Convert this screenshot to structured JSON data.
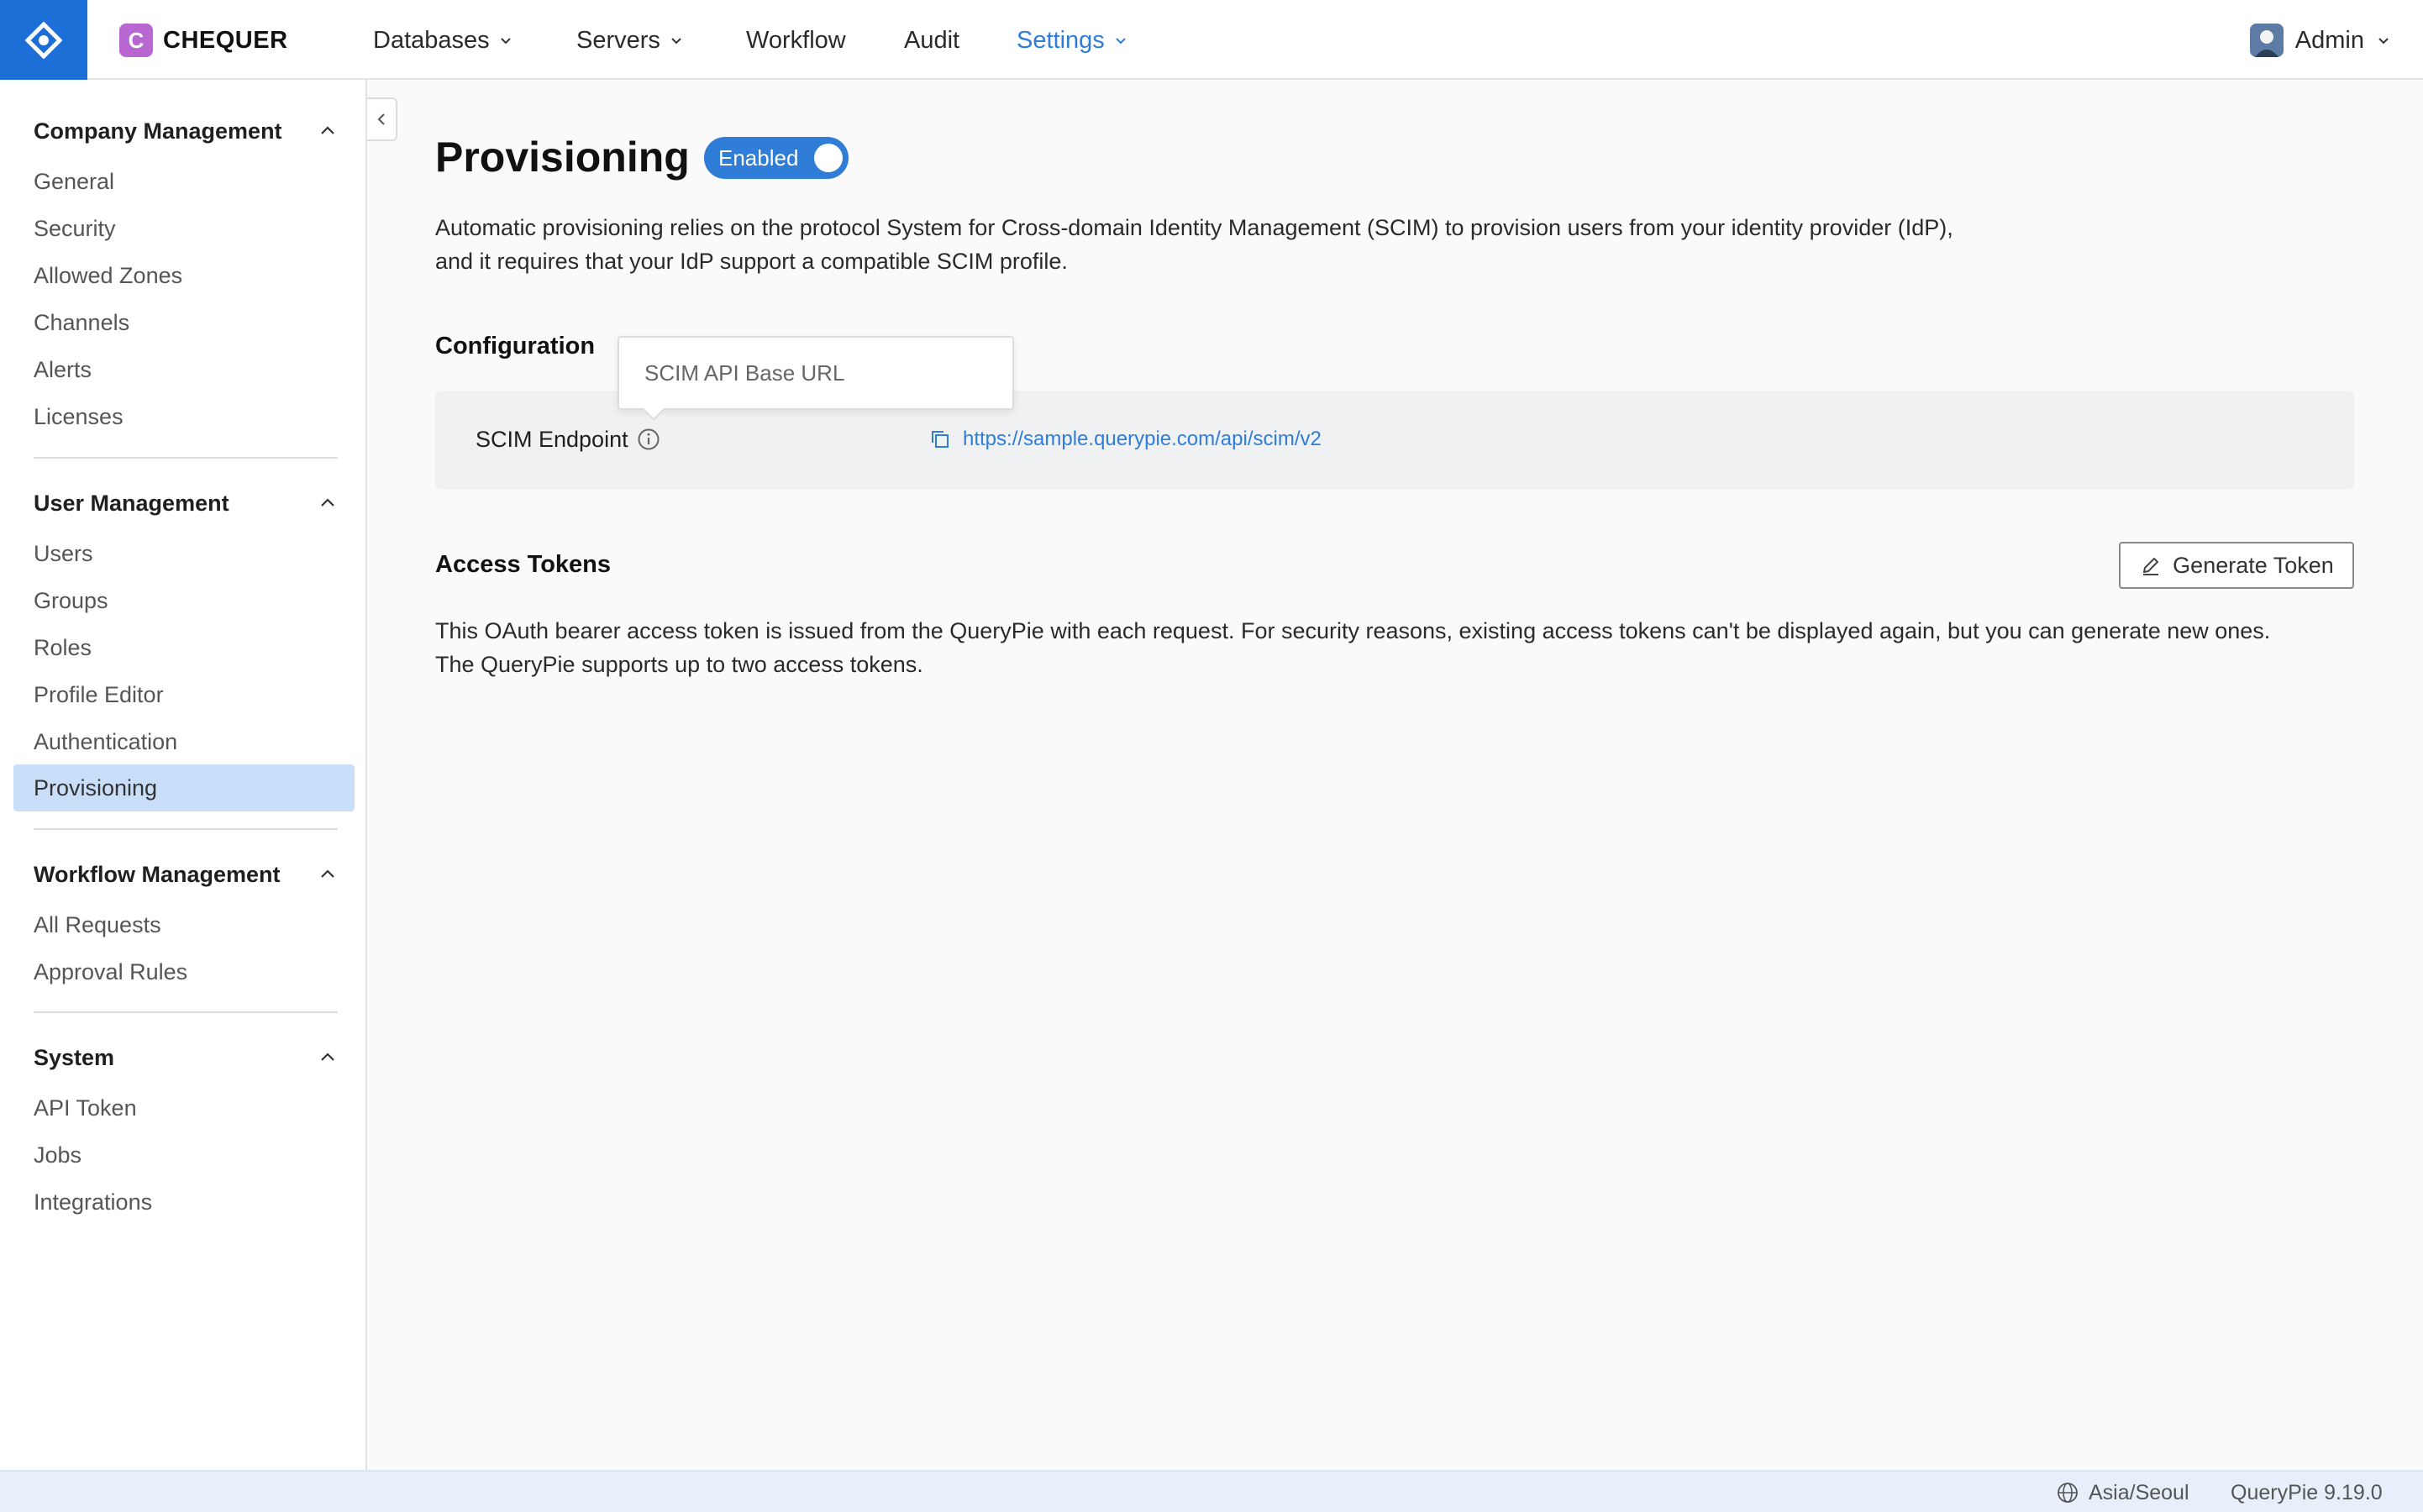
{
  "header": {
    "brand": "CHEQUER",
    "brand_badge": "C",
    "nav": [
      {
        "label": "Databases",
        "has_dropdown": true
      },
      {
        "label": "Servers",
        "has_dropdown": true
      },
      {
        "label": "Workflow",
        "has_dropdown": false
      },
      {
        "label": "Audit",
        "has_dropdown": false
      },
      {
        "label": "Settings",
        "has_dropdown": true,
        "active": true
      }
    ],
    "user": "Admin",
    "accent": "#2f7dd6",
    "logo_color": "#1d6fd8"
  },
  "sidebar": {
    "sections": [
      {
        "title": "Company Management",
        "items": [
          "General",
          "Security",
          "Allowed Zones",
          "Channels",
          "Alerts",
          "Licenses"
        ]
      },
      {
        "title": "User Management",
        "items": [
          "Users",
          "Groups",
          "Roles",
          "Profile Editor",
          "Authentication",
          "Provisioning"
        ]
      },
      {
        "title": "Workflow Management",
        "items": [
          "All Requests",
          "Approval Rules"
        ]
      },
      {
        "title": "System",
        "items": [
          "API Token",
          "Jobs",
          "Integrations"
        ]
      }
    ],
    "active_item": "Provisioning",
    "active_color": "#c8def9"
  },
  "main": {
    "title": "Provisioning",
    "toggle_label": "Enabled",
    "toggle_on": true,
    "description_line1": "Automatic provisioning relies on the protocol System for Cross-domain Identity Management (SCIM) to provision users from your identity provider (IdP),",
    "description_line2": "and it requires that your IdP support a compatible SCIM profile.",
    "configuration": {
      "heading": "Configuration",
      "endpoint_label": "SCIM Endpoint",
      "endpoint_url": "https://sample.querypie.com/api/scim/v2",
      "tooltip": "SCIM API Base URL"
    },
    "access_tokens": {
      "heading": "Access Tokens",
      "generate_button": "Generate Token",
      "description_line1": "This OAuth bearer access token is issued from the QueryPie with each request. For security reasons, existing access tokens can't be displayed again, but you can generate new ones.",
      "description_line2": "The QueryPie supports up to two access tokens."
    }
  },
  "footer": {
    "timezone": "Asia/Seoul",
    "version": "QueryPie 9.19.0"
  }
}
